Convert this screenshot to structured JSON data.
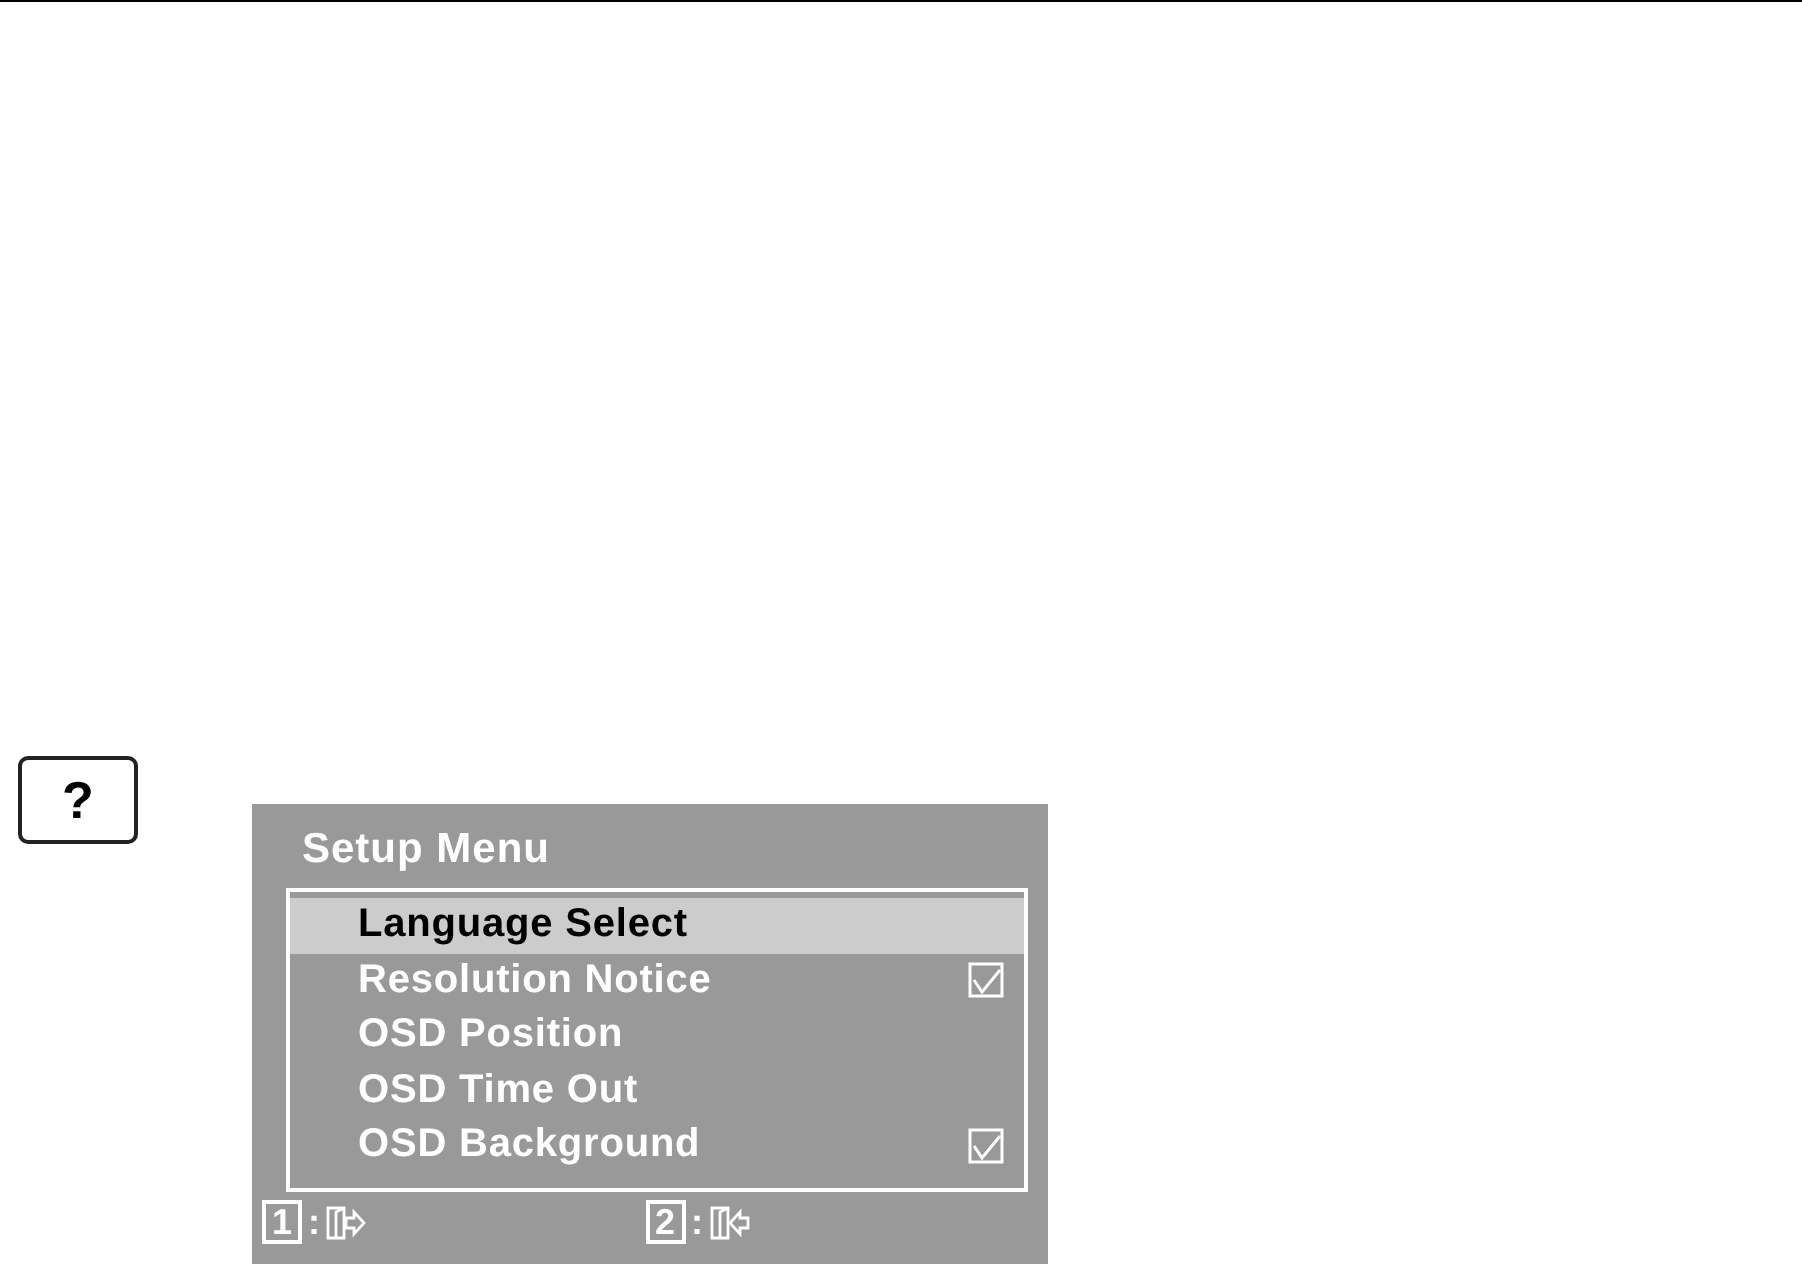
{
  "help_key": {
    "label": "?"
  },
  "osd": {
    "title": "Setup Menu",
    "items": [
      {
        "label": "Language Select",
        "selected": true,
        "kind": "plain"
      },
      {
        "label": "Resolution Notice",
        "selected": false,
        "kind": "checkbox",
        "checked": true
      },
      {
        "label": "OSD Position",
        "selected": false,
        "kind": "plain"
      },
      {
        "label": "OSD Time Out",
        "selected": false,
        "kind": "plain"
      },
      {
        "label": "OSD Background",
        "selected": false,
        "kind": "checkbox",
        "checked": true
      }
    ],
    "footer": [
      {
        "key": "1",
        "separator": ":",
        "kind": "exit"
      },
      {
        "key": "2",
        "separator": ":",
        "kind": "enter"
      }
    ]
  }
}
